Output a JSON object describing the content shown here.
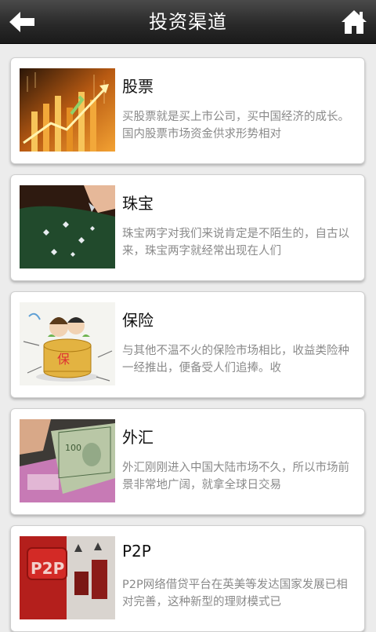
{
  "header": {
    "title": "投资渠道",
    "back_icon": "back-arrow-icon",
    "home_icon": "home-icon"
  },
  "items": [
    {
      "title": "股票",
      "description": "买股票就是买上市公司，买中国经济的成长。国内股票市场资金供求形势相对",
      "image": "stock-chart-image"
    },
    {
      "title": "珠宝",
      "description": "珠宝两字对我们来说肯定是不陌生的，自古以来，珠宝两字就经常出现在人们",
      "image": "jewelry-image"
    },
    {
      "title": "保险",
      "description": "与其他不温不火的保险市场相比，收益类险种一经推出，便备受人们追捧。收",
      "image": "insurance-image"
    },
    {
      "title": "外汇",
      "description": "外汇刚刚进入中国大陆市场不久，所以市场前景非常地广阔，就拿全球日交易",
      "image": "forex-banknotes-image"
    },
    {
      "title": "P2P",
      "description": "P2P网络借贷平台在英美等发达国家发展已相对完善，这种新型的理财模式已",
      "image": "p2p-image"
    }
  ]
}
